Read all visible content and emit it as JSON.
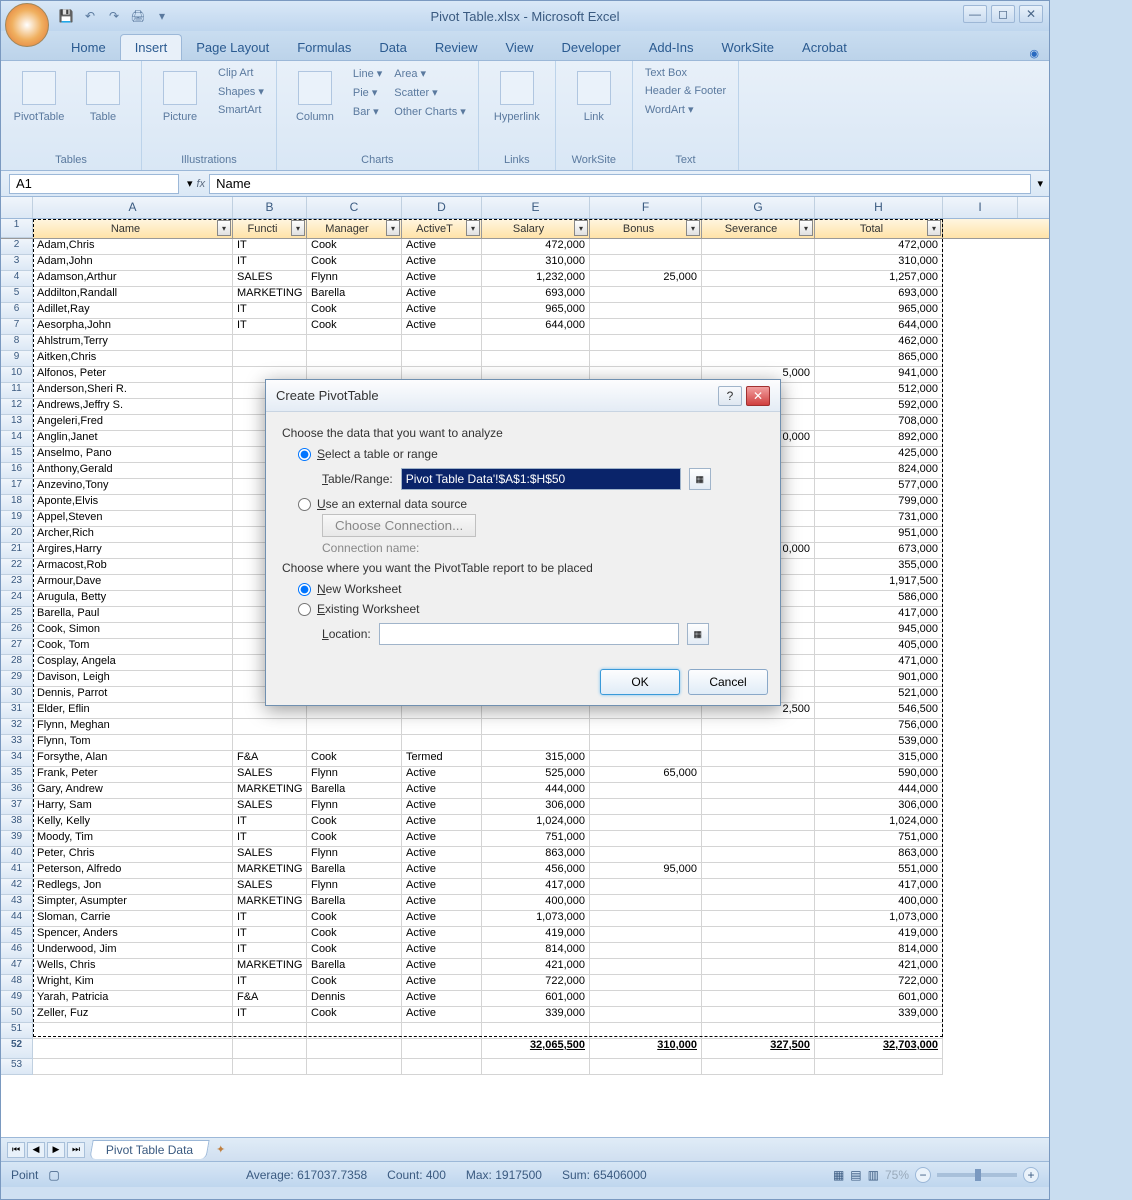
{
  "title": "Pivot Table.xlsx - Microsoft Excel",
  "tabs": [
    "Home",
    "Insert",
    "Page Layout",
    "Formulas",
    "Data",
    "Review",
    "View",
    "Developer",
    "Add-Ins",
    "WorkSite",
    "Acrobat"
  ],
  "activeTab": 1,
  "ribbon": {
    "groups": [
      {
        "label": "Tables",
        "big": [
          "PivotTable",
          "Table"
        ]
      },
      {
        "label": "Illustrations",
        "big": [
          "Picture"
        ],
        "small": [
          "Clip Art",
          "Shapes ▾",
          "SmartArt"
        ]
      },
      {
        "label": "Charts",
        "big": [
          "Column"
        ],
        "small": [
          "Line ▾",
          "Pie ▾",
          "Bar ▾",
          "Area ▾",
          "Scatter ▾",
          "Other Charts ▾"
        ]
      },
      {
        "label": "Links",
        "big": [
          "Hyperlink"
        ]
      },
      {
        "label": "WorkSite",
        "big": [
          "Link"
        ]
      },
      {
        "label": "Text",
        "small": [
          "Text Box",
          "Header & Footer",
          "WordArt ▾"
        ]
      }
    ]
  },
  "nameBox": "A1",
  "formula": "Name",
  "columns": [
    "A",
    "B",
    "C",
    "D",
    "E",
    "F",
    "G",
    "H",
    "I"
  ],
  "headers": [
    "Name",
    "Functi",
    "Manager",
    "ActiveT",
    "Salary",
    "Bonus",
    "Severance",
    "Total"
  ],
  "rows": [
    [
      "Adam,Chris",
      "IT",
      "Cook",
      "Active",
      "472,000",
      "",
      "",
      "472,000"
    ],
    [
      "Adam,John",
      "IT",
      "Cook",
      "Active",
      "310,000",
      "",
      "",
      "310,000"
    ],
    [
      "Adamson,Arthur",
      "SALES",
      "Flynn",
      "Active",
      "1,232,000",
      "25,000",
      "",
      "1,257,000"
    ],
    [
      "Addilton,Randall",
      "MARKETING",
      "Barella",
      "Active",
      "693,000",
      "",
      "",
      "693,000"
    ],
    [
      "Adillet,Ray",
      "IT",
      "Cook",
      "Active",
      "965,000",
      "",
      "",
      "965,000"
    ],
    [
      "Aesorpha,John",
      "IT",
      "Cook",
      "Active",
      "644,000",
      "",
      "",
      "644,000"
    ],
    [
      "Ahlstrum,Terry",
      "",
      "",
      "",
      "",
      "",
      "",
      "462,000"
    ],
    [
      "Aitken,Chris",
      "",
      "",
      "",
      "",
      "",
      "",
      "865,000"
    ],
    [
      "Alfonos, Peter",
      "",
      "",
      "",
      "",
      "",
      "5,000",
      "941,000"
    ],
    [
      "Anderson,Sheri R.",
      "",
      "",
      "",
      "",
      "",
      "",
      "512,000"
    ],
    [
      "Andrews,Jeffry S.",
      "",
      "",
      "",
      "",
      "",
      "",
      "592,000"
    ],
    [
      "Angeleri,Fred",
      "",
      "",
      "",
      "",
      "",
      "",
      "708,000"
    ],
    [
      "Anglin,Janet",
      "",
      "",
      "",
      "",
      "",
      "0,000",
      "892,000"
    ],
    [
      "Anselmo, Pano",
      "",
      "",
      "",
      "",
      "",
      "",
      "425,000"
    ],
    [
      "Anthony,Gerald",
      "",
      "",
      "",
      "",
      "",
      "",
      "824,000"
    ],
    [
      "Anzevino,Tony",
      "",
      "",
      "",
      "",
      "",
      "",
      "577,000"
    ],
    [
      "Aponte,Elvis",
      "",
      "",
      "",
      "",
      "",
      "",
      "799,000"
    ],
    [
      "Appel,Steven",
      "",
      "",
      "",
      "",
      "",
      "",
      "731,000"
    ],
    [
      "Archer,Rich",
      "",
      "",
      "",
      "",
      "",
      "",
      "951,000"
    ],
    [
      "Argires,Harry",
      "",
      "",
      "",
      "",
      "",
      "0,000",
      "673,000"
    ],
    [
      "Armacost,Rob",
      "",
      "",
      "",
      "",
      "",
      "",
      "355,000"
    ],
    [
      "Armour,Dave",
      "",
      "",
      "",
      "",
      "",
      "",
      "1,917,500"
    ],
    [
      "Arugula, Betty",
      "",
      "",
      "",
      "",
      "",
      "",
      "586,000"
    ],
    [
      "Barella, Paul",
      "",
      "",
      "",
      "",
      "",
      "",
      "417,000"
    ],
    [
      "Cook, Simon",
      "",
      "",
      "",
      "",
      "",
      "",
      "945,000"
    ],
    [
      "Cook, Tom",
      "",
      "",
      "",
      "",
      "",
      "",
      "405,000"
    ],
    [
      "Cosplay, Angela",
      "",
      "",
      "",
      "",
      "",
      "",
      "471,000"
    ],
    [
      "Davison, Leigh",
      "",
      "",
      "",
      "",
      "",
      "",
      "901,000"
    ],
    [
      "Dennis, Parrot",
      "",
      "",
      "",
      "",
      "",
      "",
      "521,000"
    ],
    [
      "Elder, Eflin",
      "",
      "",
      "",
      "",
      "",
      "2,500",
      "546,500"
    ],
    [
      "Flynn, Meghan",
      "",
      "",
      "",
      "",
      "",
      "",
      "756,000"
    ],
    [
      "Flynn, Tom",
      "",
      "",
      "",
      "",
      "",
      "",
      "539,000"
    ],
    [
      "Forsythe, Alan",
      "F&A",
      "Cook",
      "Termed",
      "315,000",
      "",
      "",
      "315,000"
    ],
    [
      "Frank, Peter",
      "SALES",
      "Flynn",
      "Active",
      "525,000",
      "65,000",
      "",
      "590,000"
    ],
    [
      "Gary, Andrew",
      "MARKETING",
      "Barella",
      "Active",
      "444,000",
      "",
      "",
      "444,000"
    ],
    [
      "Harry, Sam",
      "SALES",
      "Flynn",
      "Active",
      "306,000",
      "",
      "",
      "306,000"
    ],
    [
      "Kelly, Kelly",
      "IT",
      "Cook",
      "Active",
      "1,024,000",
      "",
      "",
      "1,024,000"
    ],
    [
      "Moody, Tim",
      "IT",
      "Cook",
      "Active",
      "751,000",
      "",
      "",
      "751,000"
    ],
    [
      "Peter, Chris",
      "SALES",
      "Flynn",
      "Active",
      "863,000",
      "",
      "",
      "863,000"
    ],
    [
      "Peterson, Alfredo",
      "MARKETING",
      "Barella",
      "Active",
      "456,000",
      "95,000",
      "",
      "551,000"
    ],
    [
      "Redlegs, Jon",
      "SALES",
      "Flynn",
      "Active",
      "417,000",
      "",
      "",
      "417,000"
    ],
    [
      "Simpter, Asumpter",
      "MARKETING",
      "Barella",
      "Active",
      "400,000",
      "",
      "",
      "400,000"
    ],
    [
      "Sloman, Carrie",
      "IT",
      "Cook",
      "Active",
      "1,073,000",
      "",
      "",
      "1,073,000"
    ],
    [
      "Spencer, Anders",
      "IT",
      "Cook",
      "Active",
      "419,000",
      "",
      "",
      "419,000"
    ],
    [
      "Underwood, Jim",
      "IT",
      "Cook",
      "Active",
      "814,000",
      "",
      "",
      "814,000"
    ],
    [
      "Wells, Chris",
      "MARKETING",
      "Barella",
      "Active",
      "421,000",
      "",
      "",
      "421,000"
    ],
    [
      "Wright, Kim",
      "IT",
      "Cook",
      "Active",
      "722,000",
      "",
      "",
      "722,000"
    ],
    [
      "Yarah, Patricia",
      "F&A",
      "Dennis",
      "Active",
      "601,000",
      "",
      "",
      "601,000"
    ],
    [
      "Zeller, Fuz",
      "IT",
      "Cook",
      "Active",
      "339,000",
      "",
      "",
      "339,000"
    ]
  ],
  "totals": [
    "",
    "",
    "",
    "",
    "32,065,500",
    "310,000",
    "327,500",
    "32,703,000"
  ],
  "sheetTab": "Pivot Table Data",
  "status": {
    "mode": "Point",
    "avg": "Average: 617037.7358",
    "count": "Count: 400",
    "max": "Max: 1917500",
    "sum": "Sum: 65406000",
    "zoom": "75%"
  },
  "dialog": {
    "title": "Create PivotTable",
    "choose1": "Choose the data that you want to analyze",
    "opt1": "Select a table or range",
    "rangeLabel": "Table/Range:",
    "range": "Pivot Table Data'!$A$1:$H$50",
    "opt2": "Use an external data source",
    "connBtn": "Choose Connection...",
    "connLabel": "Connection name:",
    "choose2": "Choose where you want the PivotTable report to be placed",
    "opt3": "New Worksheet",
    "opt4": "Existing Worksheet",
    "locLabel": "Location:",
    "ok": "OK",
    "cancel": "Cancel"
  }
}
